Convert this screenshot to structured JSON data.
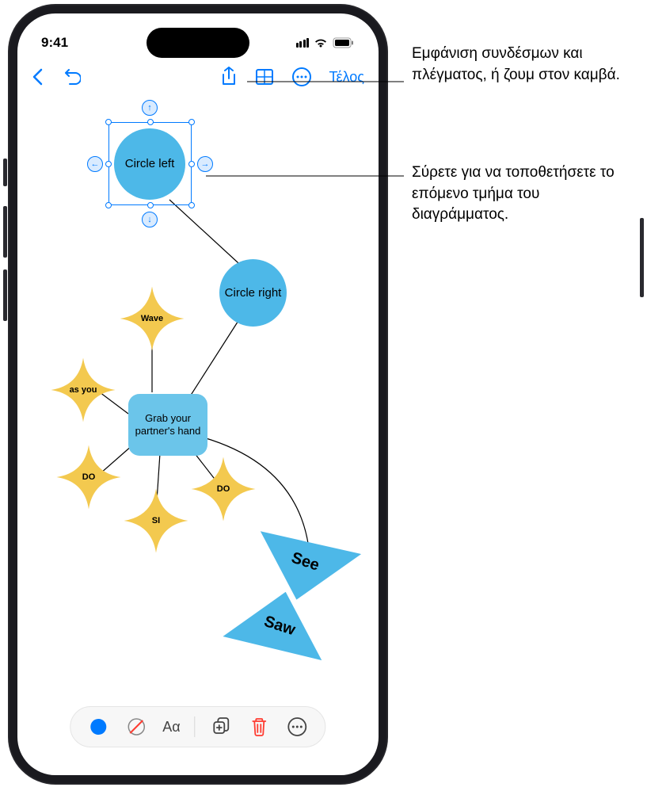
{
  "status": {
    "time": "9:41"
  },
  "toolbar": {
    "done": "Τέλος"
  },
  "bottom_toolbar": {
    "text_btn": "Αα"
  },
  "shapes": {
    "circle_left": "Circle left",
    "circle_right": "Circle right",
    "grab": "Grab your partner's hand",
    "wave": "Wave",
    "as_you": "as you",
    "do1": "DO",
    "do2": "DO",
    "si": "SI",
    "see": "See",
    "saw": "Saw"
  },
  "annotations": {
    "a1": "Εμφάνιση συνδέσμων και πλέγματος, ή ζουμ στον καμβά.",
    "a2": "Σύρετε για να τοποθετήσετε το επόμενο τμήμα του διαγράμματος."
  },
  "colors": {
    "blue": "#4db8e8",
    "blue_light": "#6bc5ea",
    "gold": "#f3c94f",
    "ios_blue": "#007aff",
    "red": "#ff3b30"
  }
}
